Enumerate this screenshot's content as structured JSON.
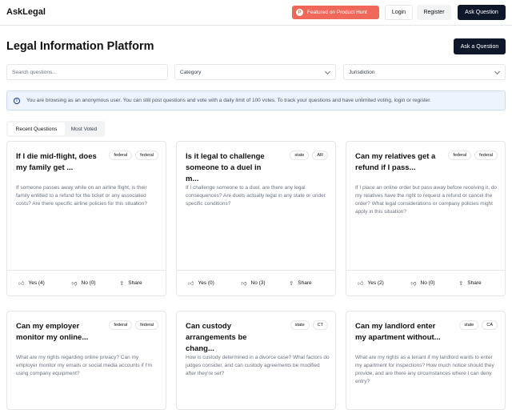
{
  "header": {
    "brand": "AskLegal",
    "product_hunt": "Featured on Product Hunt",
    "login": "Login",
    "register": "Register",
    "ask": "Ask Question"
  },
  "main": {
    "title": "Legal Information Platform",
    "ask_button": "Ask a Question"
  },
  "filters": {
    "search_placeholder": "Search questions...",
    "category": "Category",
    "jurisdiction": "Jurisdiction"
  },
  "notice": {
    "text": "You are browsing as an anonymous user. You can still post questions and vote with a daily limit of 100 votes. To track your questions and have unlimited voting, login or register."
  },
  "tabs": [
    {
      "label": "Recent Questions",
      "active": true
    },
    {
      "label": "Most Voted",
      "active": false
    }
  ],
  "cards": [
    {
      "title": "If I die mid-flight, does my family get ...",
      "tags": [
        "federal",
        "federal"
      ],
      "body": "If someone passes away while on an airline flight, is their family entitled to a refund for the ticket or any associated costs? Are there specific airline policies for this situation?",
      "yes": "Yes (4)",
      "no": "No (0)",
      "share": "Share"
    },
    {
      "title": "Is it legal to challenge someone to a duel in m...",
      "tags": [
        "state",
        "AR"
      ],
      "body": "If I challenge someone to a duel, are there any legal consequences? Are duels actually legal in any state or under specific conditions?",
      "yes": "Yes (0)",
      "no": "No (3)",
      "share": "Share"
    },
    {
      "title": "Can my relatives get a refund if I pass...",
      "tags": [
        "federal",
        "federal"
      ],
      "body": "If I place an online order but pass away before receiving it, do my relatives have the right to request a refund or cancel the order? What legal considerations or company policies might apply in this situation?",
      "yes": "Yes (2)",
      "no": "No (0)",
      "share": "Share"
    },
    {
      "title": "Can my employer monitor my online...",
      "tags": [
        "federal",
        "federal"
      ],
      "body": "What are my rights regarding online privacy? Can my employer monitor my emails or social media accounts if I'm using company equipment?",
      "yes": "",
      "no": "",
      "share": ""
    },
    {
      "title": "Can custody arrangements be chang...",
      "tags": [
        "state",
        "CT"
      ],
      "body": "How is custody determined in a divorce case? What factors do judges consider, and can custody agreements be modified after they're set?",
      "yes": "",
      "no": "",
      "share": ""
    },
    {
      "title": "Can my landlord enter my apartment without...",
      "tags": [
        "state",
        "CA"
      ],
      "body": "What are my rights as a tenant if my landlord wants to enter my apartment for inspections? How much notice should they provide, and are there any circumstances where I can deny entry?",
      "yes": "",
      "no": "",
      "share": ""
    }
  ],
  "icons": {
    "info": "info-icon",
    "thumb_up": "thumbs-up-icon",
    "thumb_down": "thumbs-down-icon",
    "share": "share-icon"
  },
  "colors": {
    "accent_dark": "#0f172a",
    "product_hunt": "#f06859",
    "notice_bg": "#eef4fd"
  }
}
